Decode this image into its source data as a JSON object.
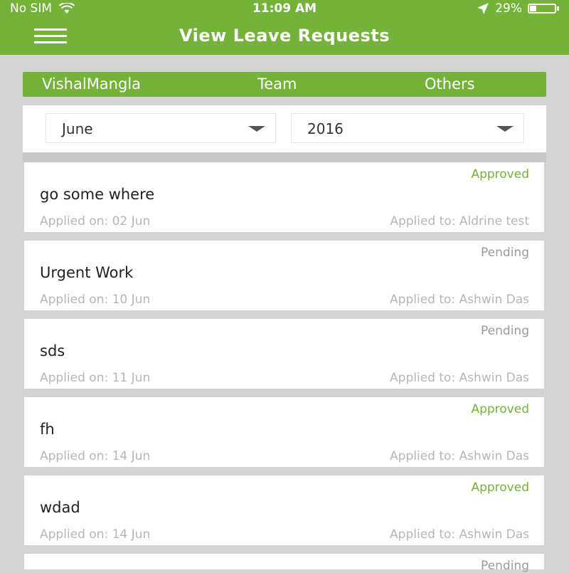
{
  "status_bar": {
    "carrier": "No SIM",
    "time": "11:09 AM",
    "battery_text": "29%",
    "battery_level": 0.29,
    "icons": [
      "wifi-icon",
      "location-arrow-icon",
      "battery-icon"
    ]
  },
  "header": {
    "title": "View Leave Requests",
    "menu_icon": "hamburger-menu-icon"
  },
  "tabs": [
    "VishalMangla",
    "Team",
    "Others"
  ],
  "filters": {
    "month": "June",
    "year": "2016",
    "caret_icon": "dropdown-caret-icon"
  },
  "requests": [
    {
      "status": "Approved",
      "reason": "go some where",
      "applied_on": "Applied on: 02 Jun",
      "applied_to": "Applied to: Aldrine test"
    },
    {
      "status": "Pending",
      "reason": "Urgent Work",
      "applied_on": "Applied on: 10 Jun",
      "applied_to": "Applied to: Ashwin Das"
    },
    {
      "status": "Pending",
      "reason": "sds",
      "applied_on": "Applied on: 11 Jun",
      "applied_to": "Applied to: Ashwin Das"
    },
    {
      "status": "Approved",
      "reason": "fh",
      "applied_on": "Applied on: 14 Jun",
      "applied_to": "Applied to: Ashwin Das"
    },
    {
      "status": "Approved",
      "reason": "wdad",
      "applied_on": "Applied on: 14 Jun",
      "applied_to": "Applied to: Ashwin Das"
    },
    {
      "status": "Pending",
      "reason": "",
      "applied_on": "",
      "applied_to": ""
    }
  ],
  "colors": {
    "brand_green": "#74b23a",
    "background": "#d4d4d4",
    "approved": "#74b23a",
    "pending": "#9a9a9a",
    "meta_text": "#b6b6b6"
  }
}
